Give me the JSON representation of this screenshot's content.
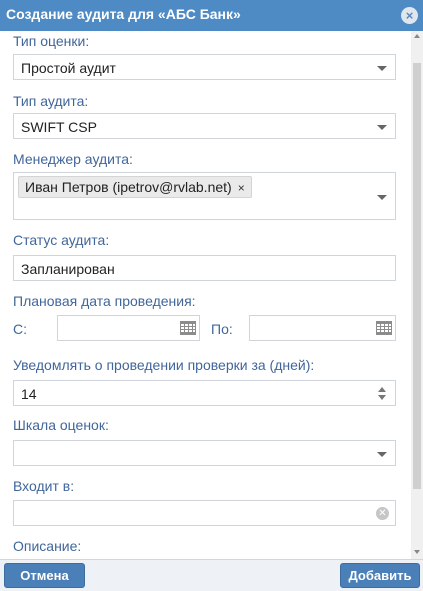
{
  "dialog": {
    "title": "Создание аудита для «АБС Банк»",
    "close_glyph": "×"
  },
  "form": {
    "assessment_type": {
      "label": "Тип оценки:",
      "value": "Простой аудит"
    },
    "audit_type": {
      "label": "Тип аудита:",
      "value": "SWIFT CSP"
    },
    "audit_manager": {
      "label": "Менеджер аудита:",
      "selected": "Иван Петров (ipetrov@rvlab.net)",
      "remove_glyph": "×"
    },
    "audit_status": {
      "label": "Статус аудита:",
      "value": "Запланирован"
    },
    "planned_date": {
      "label": "Плановая дата проведения:",
      "from_label": "С:",
      "to_label": "По:",
      "from_value": "",
      "to_value": ""
    },
    "notify": {
      "label": "Уведомлять о проведении проверки за (дней):",
      "value": "14"
    },
    "rating_scale": {
      "label": "Шкала оценок:",
      "value": ""
    },
    "part_of": {
      "label": "Входит в:",
      "value": ""
    },
    "description": {
      "label": "Описание:"
    }
  },
  "footer": {
    "cancel_label": "Отмена",
    "add_label": "Добавить"
  },
  "colors": {
    "header": "#4e8ac3",
    "label": "#41669a",
    "button": "#4a7fb8"
  }
}
